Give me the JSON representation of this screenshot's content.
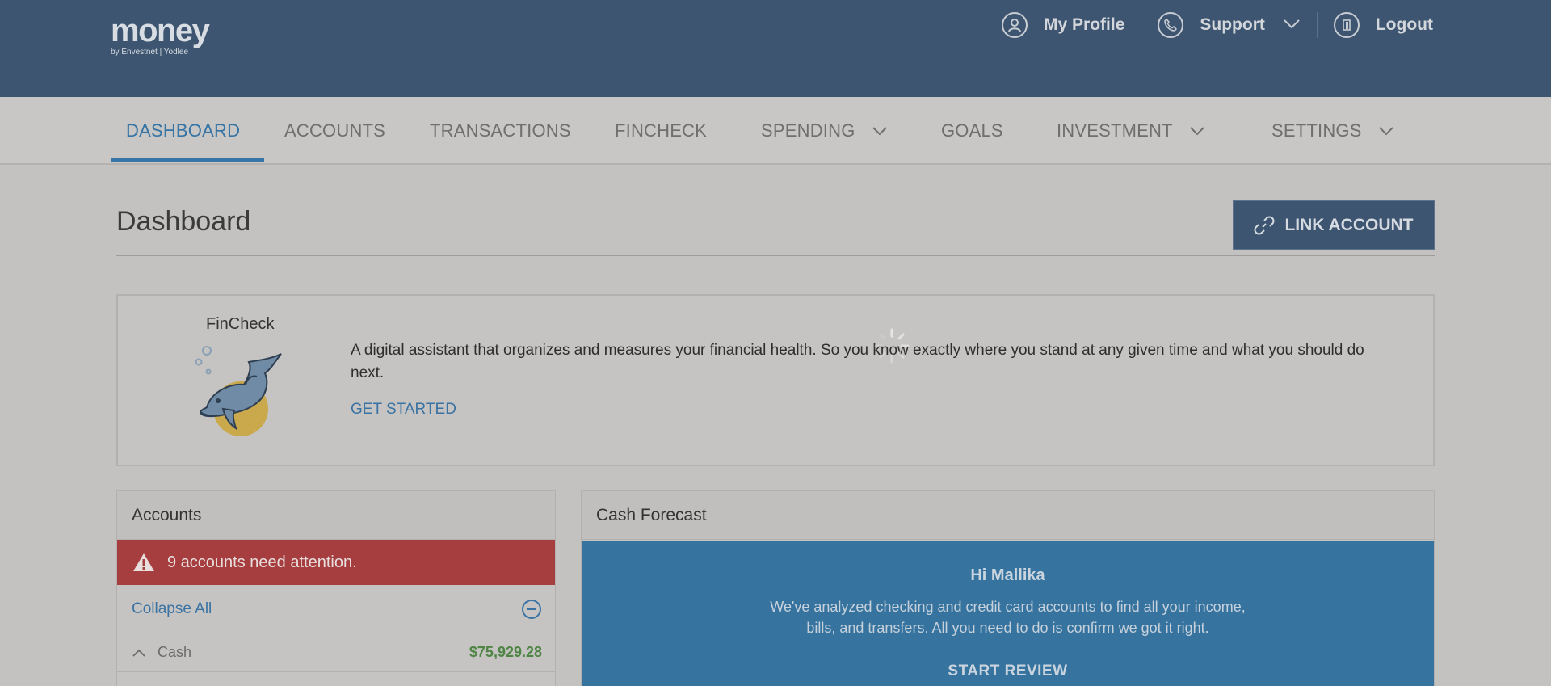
{
  "header": {
    "logo": "money",
    "logo_sub": "by Envestnet | Yodlee",
    "my_profile": "My Profile",
    "support": "Support",
    "logout": "Logout"
  },
  "nav": {
    "dashboard": "DASHBOARD",
    "accounts": "ACCOUNTS",
    "transactions": "TRANSACTIONS",
    "fincheck": "FINCHECK",
    "spending": "SPENDING",
    "goals": "GOALS",
    "investment": "INVESTMENT",
    "settings": "SETTINGS",
    "active": "DASHBOARD"
  },
  "page": {
    "title": "Dashboard",
    "link_account": "LINK ACCOUNT"
  },
  "fincheck": {
    "label": "FinCheck",
    "description": "A digital assistant that organizes and measures your financial health. So you know exactly where you stand at any given time and what you should do next.",
    "cta": "GET STARTED"
  },
  "accounts": {
    "title": "Accounts",
    "alert": "9 accounts need attention.",
    "collapse": "Collapse All",
    "cash_label": "Cash",
    "cash_amount": "$75,929.28"
  },
  "cash_forecast": {
    "title": "Cash Forecast",
    "greeting": "Hi Mallika",
    "message_line1": "We've analyzed checking and credit card accounts to find all your income,",
    "message_line2": "bills, and transfers. All you need to do is confirm we got it right.",
    "button": "START REVIEW"
  },
  "colors": {
    "header_bg": "#3d5571",
    "accent": "#3675a6",
    "alert": "#a63d3e",
    "positive": "#4f8544"
  },
  "icons": [
    "user-circle-icon",
    "phone-icon",
    "chevron-down-icon",
    "logout-door-icon",
    "link-icon",
    "warning-icon",
    "minus-circle-icon",
    "chevron-up-icon",
    "loading-spinner-icon"
  ]
}
